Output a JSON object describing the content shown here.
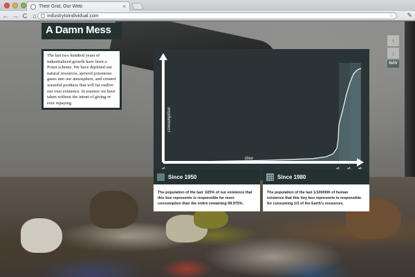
{
  "browser": {
    "tab_title": "Their Grid, Our Web",
    "tab_close": "×",
    "url": "industrytoindividual.com",
    "back": "←",
    "forward": "→",
    "reload": "C",
    "home": "⌂",
    "star": "☆",
    "wrench": "✎"
  },
  "page": {
    "title": "A Damn Mess",
    "intro": "The last two hundred years of industrialized growth have been a Ponzi scheme. We have depleted our natural resources, spewed poisonous gases into our atmosphere, and created wasteful products that will far outlive our own existence. In essence we have taken without the intent of giving or ever repaying."
  },
  "chart_data": {
    "type": "area",
    "ylabel": "consumption",
    "xlabel": "time",
    "x_tick_labels": [
      "12,000 BCE",
      "1950",
      "1980",
      "2012"
    ],
    "series": [
      {
        "x": [
          -12000,
          -8000,
          -4000,
          0,
          1000,
          1500,
          1800,
          1900,
          1950,
          1960,
          1970,
          1980,
          1990,
          2000,
          2005,
          2012
        ],
        "values": [
          0,
          1,
          2,
          4,
          6,
          9,
          15,
          25,
          40,
          55,
          72,
          85,
          94,
          98,
          99,
          100
        ]
      }
    ],
    "highlight_ranges": [
      {
        "from": 1950,
        "to": 2012
      },
      {
        "from": 1980,
        "to": 2012
      }
    ],
    "colors": {
      "background": "#2a3436",
      "fill": "#5f7c80",
      "line": "#ffffff"
    }
  },
  "nav": {
    "up": "↑",
    "down": "↓",
    "label": "NAV"
  },
  "cards": [
    {
      "title": "Since 1950",
      "text": "The population of the last .025% of our existence that this box represents is responsible for more consumption than the entire remaining 99.975%."
    },
    {
      "title": "Since 1980",
      "text": "The population of the last 1/10000th of human existence that this tiny box represents is responsible for consuming 1/3 of the Earth's resources."
    }
  ]
}
